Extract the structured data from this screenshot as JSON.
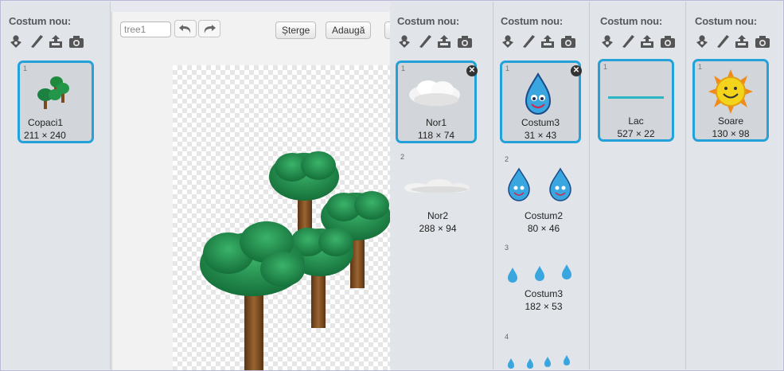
{
  "panels": [
    {
      "title": "Costum nou:",
      "costumes": [
        {
          "num": "1",
          "name": "Copaci1",
          "size": "211 × 240",
          "selected": true
        }
      ]
    },
    {
      "title": "Costum nou:",
      "costumes": [
        {
          "num": "1",
          "name": "Nor1",
          "size": "118 × 74",
          "selected": true
        },
        {
          "num": "2",
          "name": "Nor2",
          "size": "288 × 94",
          "selected": false
        }
      ]
    },
    {
      "title": "Costum nou:",
      "costumes": [
        {
          "num": "1",
          "name": "Costum3",
          "size": "31 × 43",
          "selected": true
        },
        {
          "num": "2",
          "name": "Costum2",
          "size": "80 × 46",
          "selected": false
        },
        {
          "num": "3",
          "name": "Costum3",
          "size": "182 × 53",
          "selected": false
        },
        {
          "num": "4",
          "name": "",
          "size": "",
          "selected": false
        }
      ]
    },
    {
      "title": "Costum nou:",
      "costumes": [
        {
          "num": "1",
          "name": "Lac",
          "size": "527 × 22",
          "selected": true
        }
      ]
    },
    {
      "title": "Costum nou:",
      "costumes": [
        {
          "num": "1",
          "name": "Soare",
          "size": "130 × 98",
          "selected": true
        }
      ]
    }
  ],
  "editor": {
    "costume_name": "tree1",
    "delete_label": "Șterge",
    "add_label": "Adaugă"
  },
  "tools": [
    "choose-from-library-icon",
    "paint-icon",
    "upload-icon",
    "camera-icon"
  ],
  "colors": {
    "selection_border": "#24a1d9",
    "panel_bg": "#e1e4e8",
    "tree_green": "#1f8a3e",
    "trunk_brown": "#7a4a20",
    "drop_blue": "#3aa6df",
    "sun_yellow": "#f3d31c",
    "lake_cyan": "#2bb6c4"
  }
}
